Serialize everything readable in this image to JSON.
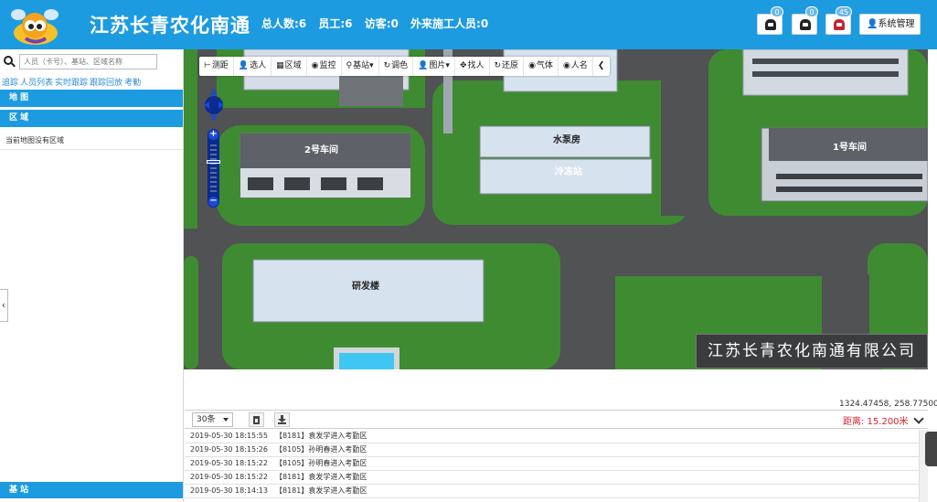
{
  "header": {
    "title": "江苏长青农化南通",
    "stats": {
      "total": "总人数:6",
      "staff": "员工:6",
      "visitors": "访客:0",
      "contractors": "外来施工人员:0"
    },
    "alerts": [
      {
        "icon": "alarm-icon",
        "count": "0"
      },
      {
        "icon": "alarm-icon",
        "count": "0"
      },
      {
        "icon": "alarm-icon",
        "count": "45"
      }
    ],
    "admin_label": "系统管理"
  },
  "left_panel": {
    "search_placeholder": "人员（卡号）、基站、区域名称",
    "links": [
      "追踪",
      "人员列表",
      "实时跟踪",
      "跟踪回放",
      "考勤"
    ],
    "map_section": "地  图",
    "area_section": "区  域",
    "no_area_text": "当前地图没有区域",
    "base_section": "基  站"
  },
  "toolbar": [
    {
      "icon": "ruler-icon",
      "glyph": "⊢",
      "label": "测距"
    },
    {
      "icon": "person-icon",
      "glyph": "👤",
      "label": "选人"
    },
    {
      "icon": "area-icon",
      "glyph": "▦",
      "label": "区域"
    },
    {
      "icon": "eye-icon",
      "glyph": "◉",
      "label": "监控"
    },
    {
      "icon": "pin-icon",
      "glyph": "⚲",
      "label": "基站▾"
    },
    {
      "icon": "palette-icon",
      "glyph": "↻",
      "label": "调色"
    },
    {
      "icon": "person-icon",
      "glyph": "👤",
      "label": "图片▾"
    },
    {
      "icon": "move-icon",
      "glyph": "✥",
      "label": "找人"
    },
    {
      "icon": "refresh-icon",
      "glyph": "↻",
      "label": "还原"
    },
    {
      "icon": "eye-icon",
      "glyph": "◉",
      "label": "气体"
    },
    {
      "icon": "eye-icon",
      "glyph": "◉",
      "label": "人名"
    },
    {
      "icon": "collapse-left-icon",
      "glyph": "❮",
      "label": ""
    }
  ],
  "map": {
    "buildings": {
      "workshop2": "2号车间",
      "pump": "水泵房",
      "freezer": "冷冻站",
      "workshop1": "1号车间",
      "rnd": "研发楼"
    },
    "company_name": "江苏长青农化南通有限公司",
    "colors": {
      "grass": "#3f8b32",
      "road": "#505254",
      "roof": "#d7e2ef"
    }
  },
  "coords": "1324.47458, 258.77500",
  "log": {
    "page_size": "30条",
    "distance": "距离: 15.200米",
    "rows": [
      {
        "time": "2019-05-30 18:15:55",
        "text": "【8181】袁发学进入考勤区"
      },
      {
        "time": "2019-05-30 18:15:26",
        "text": "【8105】孙明春进入考勤区"
      },
      {
        "time": "2019-05-30 18:15:22",
        "text": "【8105】孙明春进入考勤区"
      },
      {
        "time": "2019-05-30 18:15:22",
        "text": "【8181】袁发学进入考勤区"
      },
      {
        "time": "2019-05-30 18:14:13",
        "text": "【8181】袁发学进入考勤区"
      }
    ]
  }
}
